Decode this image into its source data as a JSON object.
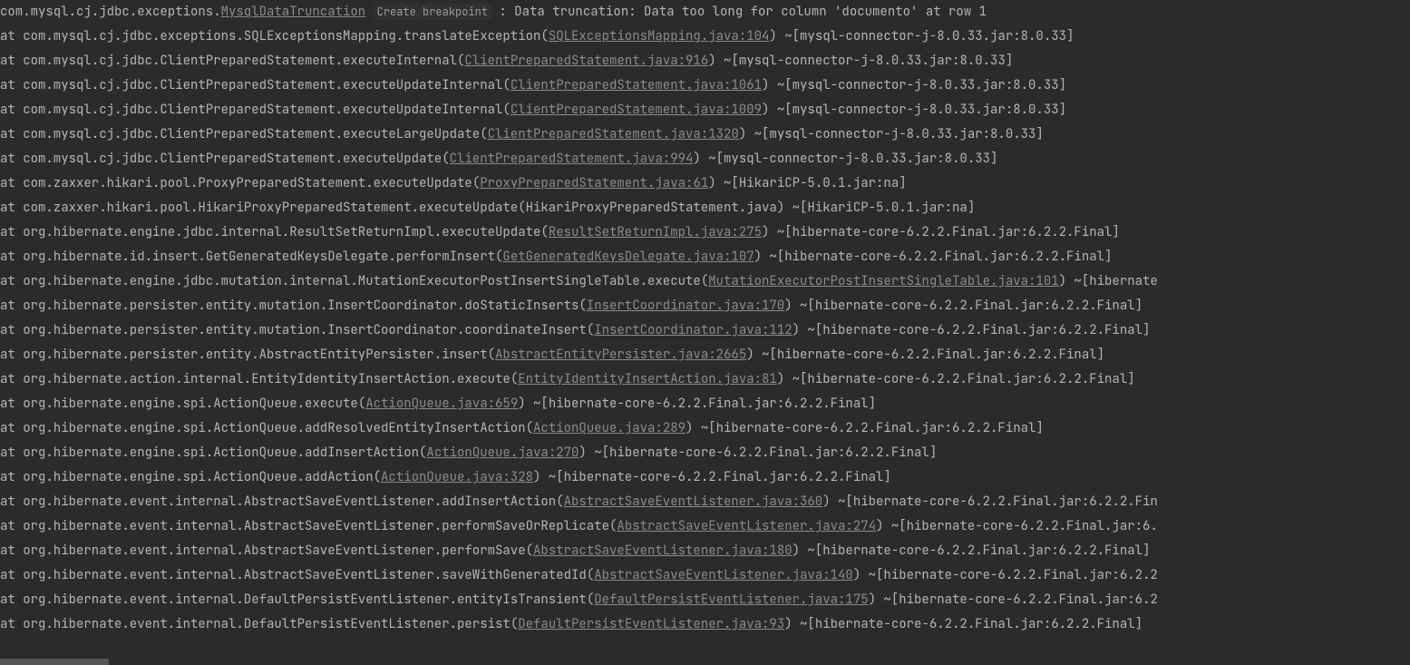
{
  "exception": {
    "prefix": "com.mysql.cj.jdbc.exceptions.",
    "class": "MysqlDataTruncation",
    "breakpoint": "Create breakpoint",
    "sep": " : ",
    "message": "Data truncation: Data too long for column 'documento' at row 1"
  },
  "frames": [
    {
      "method": "com.mysql.cj.jdbc.exceptions.SQLExceptionsMapping.translateException",
      "link": "SQLExceptionsMapping.java:104",
      "suffix": " ~[mysql-connector-j-8.0.33.jar:8.0.33]"
    },
    {
      "method": "com.mysql.cj.jdbc.ClientPreparedStatement.executeInternal",
      "link": "ClientPreparedStatement.java:916",
      "suffix": " ~[mysql-connector-j-8.0.33.jar:8.0.33]"
    },
    {
      "method": "com.mysql.cj.jdbc.ClientPreparedStatement.executeUpdateInternal",
      "link": "ClientPreparedStatement.java:1061",
      "suffix": " ~[mysql-connector-j-8.0.33.jar:8.0.33]"
    },
    {
      "method": "com.mysql.cj.jdbc.ClientPreparedStatement.executeUpdateInternal",
      "link": "ClientPreparedStatement.java:1009",
      "suffix": " ~[mysql-connector-j-8.0.33.jar:8.0.33]"
    },
    {
      "method": "com.mysql.cj.jdbc.ClientPreparedStatement.executeLargeUpdate",
      "link": "ClientPreparedStatement.java:1320",
      "suffix": " ~[mysql-connector-j-8.0.33.jar:8.0.33]"
    },
    {
      "method": "com.mysql.cj.jdbc.ClientPreparedStatement.executeUpdate",
      "link": "ClientPreparedStatement.java:994",
      "suffix": " ~[mysql-connector-j-8.0.33.jar:8.0.33]"
    },
    {
      "method": "com.zaxxer.hikari.pool.ProxyPreparedStatement.executeUpdate",
      "link": "ProxyPreparedStatement.java:61",
      "suffix": " ~[HikariCP-5.0.1.jar:na]"
    },
    {
      "method": "com.zaxxer.hikari.pool.HikariProxyPreparedStatement.executeUpdate",
      "nolink": "HikariProxyPreparedStatement.java",
      "suffix": " ~[HikariCP-5.0.1.jar:na]"
    },
    {
      "method": "org.hibernate.engine.jdbc.internal.ResultSetReturnImpl.executeUpdate",
      "link": "ResultSetReturnImpl.java:275",
      "suffix": " ~[hibernate-core-6.2.2.Final.jar:6.2.2.Final]"
    },
    {
      "method": "org.hibernate.id.insert.GetGeneratedKeysDelegate.performInsert",
      "link": "GetGeneratedKeysDelegate.java:107",
      "suffix": " ~[hibernate-core-6.2.2.Final.jar:6.2.2.Final]"
    },
    {
      "method": "org.hibernate.engine.jdbc.mutation.internal.MutationExecutorPostInsertSingleTable.execute",
      "link": "MutationExecutorPostInsertSingleTable.java:101",
      "suffix": " ~[hibernate"
    },
    {
      "method": "org.hibernate.persister.entity.mutation.InsertCoordinator.doStaticInserts",
      "link": "InsertCoordinator.java:170",
      "suffix": " ~[hibernate-core-6.2.2.Final.jar:6.2.2.Final]"
    },
    {
      "method": "org.hibernate.persister.entity.mutation.InsertCoordinator.coordinateInsert",
      "link": "InsertCoordinator.java:112",
      "suffix": " ~[hibernate-core-6.2.2.Final.jar:6.2.2.Final]"
    },
    {
      "method": "org.hibernate.persister.entity.AbstractEntityPersister.insert",
      "link": "AbstractEntityPersister.java:2665",
      "suffix": " ~[hibernate-core-6.2.2.Final.jar:6.2.2.Final]"
    },
    {
      "method": "org.hibernate.action.internal.EntityIdentityInsertAction.execute",
      "link": "EntityIdentityInsertAction.java:81",
      "suffix": " ~[hibernate-core-6.2.2.Final.jar:6.2.2.Final]"
    },
    {
      "method": "org.hibernate.engine.spi.ActionQueue.execute",
      "link": "ActionQueue.java:659",
      "suffix": " ~[hibernate-core-6.2.2.Final.jar:6.2.2.Final]"
    },
    {
      "method": "org.hibernate.engine.spi.ActionQueue.addResolvedEntityInsertAction",
      "link": "ActionQueue.java:289",
      "suffix": " ~[hibernate-core-6.2.2.Final.jar:6.2.2.Final]"
    },
    {
      "method": "org.hibernate.engine.spi.ActionQueue.addInsertAction",
      "link": "ActionQueue.java:270",
      "suffix": " ~[hibernate-core-6.2.2.Final.jar:6.2.2.Final]"
    },
    {
      "method": "org.hibernate.engine.spi.ActionQueue.addAction",
      "link": "ActionQueue.java:328",
      "suffix": " ~[hibernate-core-6.2.2.Final.jar:6.2.2.Final]"
    },
    {
      "method": "org.hibernate.event.internal.AbstractSaveEventListener.addInsertAction",
      "link": "AbstractSaveEventListener.java:360",
      "suffix": " ~[hibernate-core-6.2.2.Final.jar:6.2.2.Fin"
    },
    {
      "method": "org.hibernate.event.internal.AbstractSaveEventListener.performSaveOrReplicate",
      "link": "AbstractSaveEventListener.java:274",
      "suffix": " ~[hibernate-core-6.2.2.Final.jar:6."
    },
    {
      "method": "org.hibernate.event.internal.AbstractSaveEventListener.performSave",
      "link": "AbstractSaveEventListener.java:180",
      "suffix": " ~[hibernate-core-6.2.2.Final.jar:6.2.2.Final]"
    },
    {
      "method": "org.hibernate.event.internal.AbstractSaveEventListener.saveWithGeneratedId",
      "link": "AbstractSaveEventListener.java:140",
      "suffix": " ~[hibernate-core-6.2.2.Final.jar:6.2.2"
    },
    {
      "method": "org.hibernate.event.internal.DefaultPersistEventListener.entityIsTransient",
      "link": "DefaultPersistEventListener.java:175",
      "suffix": " ~[hibernate-core-6.2.2.Final.jar:6.2"
    },
    {
      "method": "org.hibernate.event.internal.DefaultPersistEventListener.persist",
      "link": "DefaultPersistEventListener.java:93",
      "suffix": " ~[hibernate-core-6.2.2.Final.jar:6.2.2.Final]"
    }
  ],
  "labels": {
    "at": "at "
  }
}
